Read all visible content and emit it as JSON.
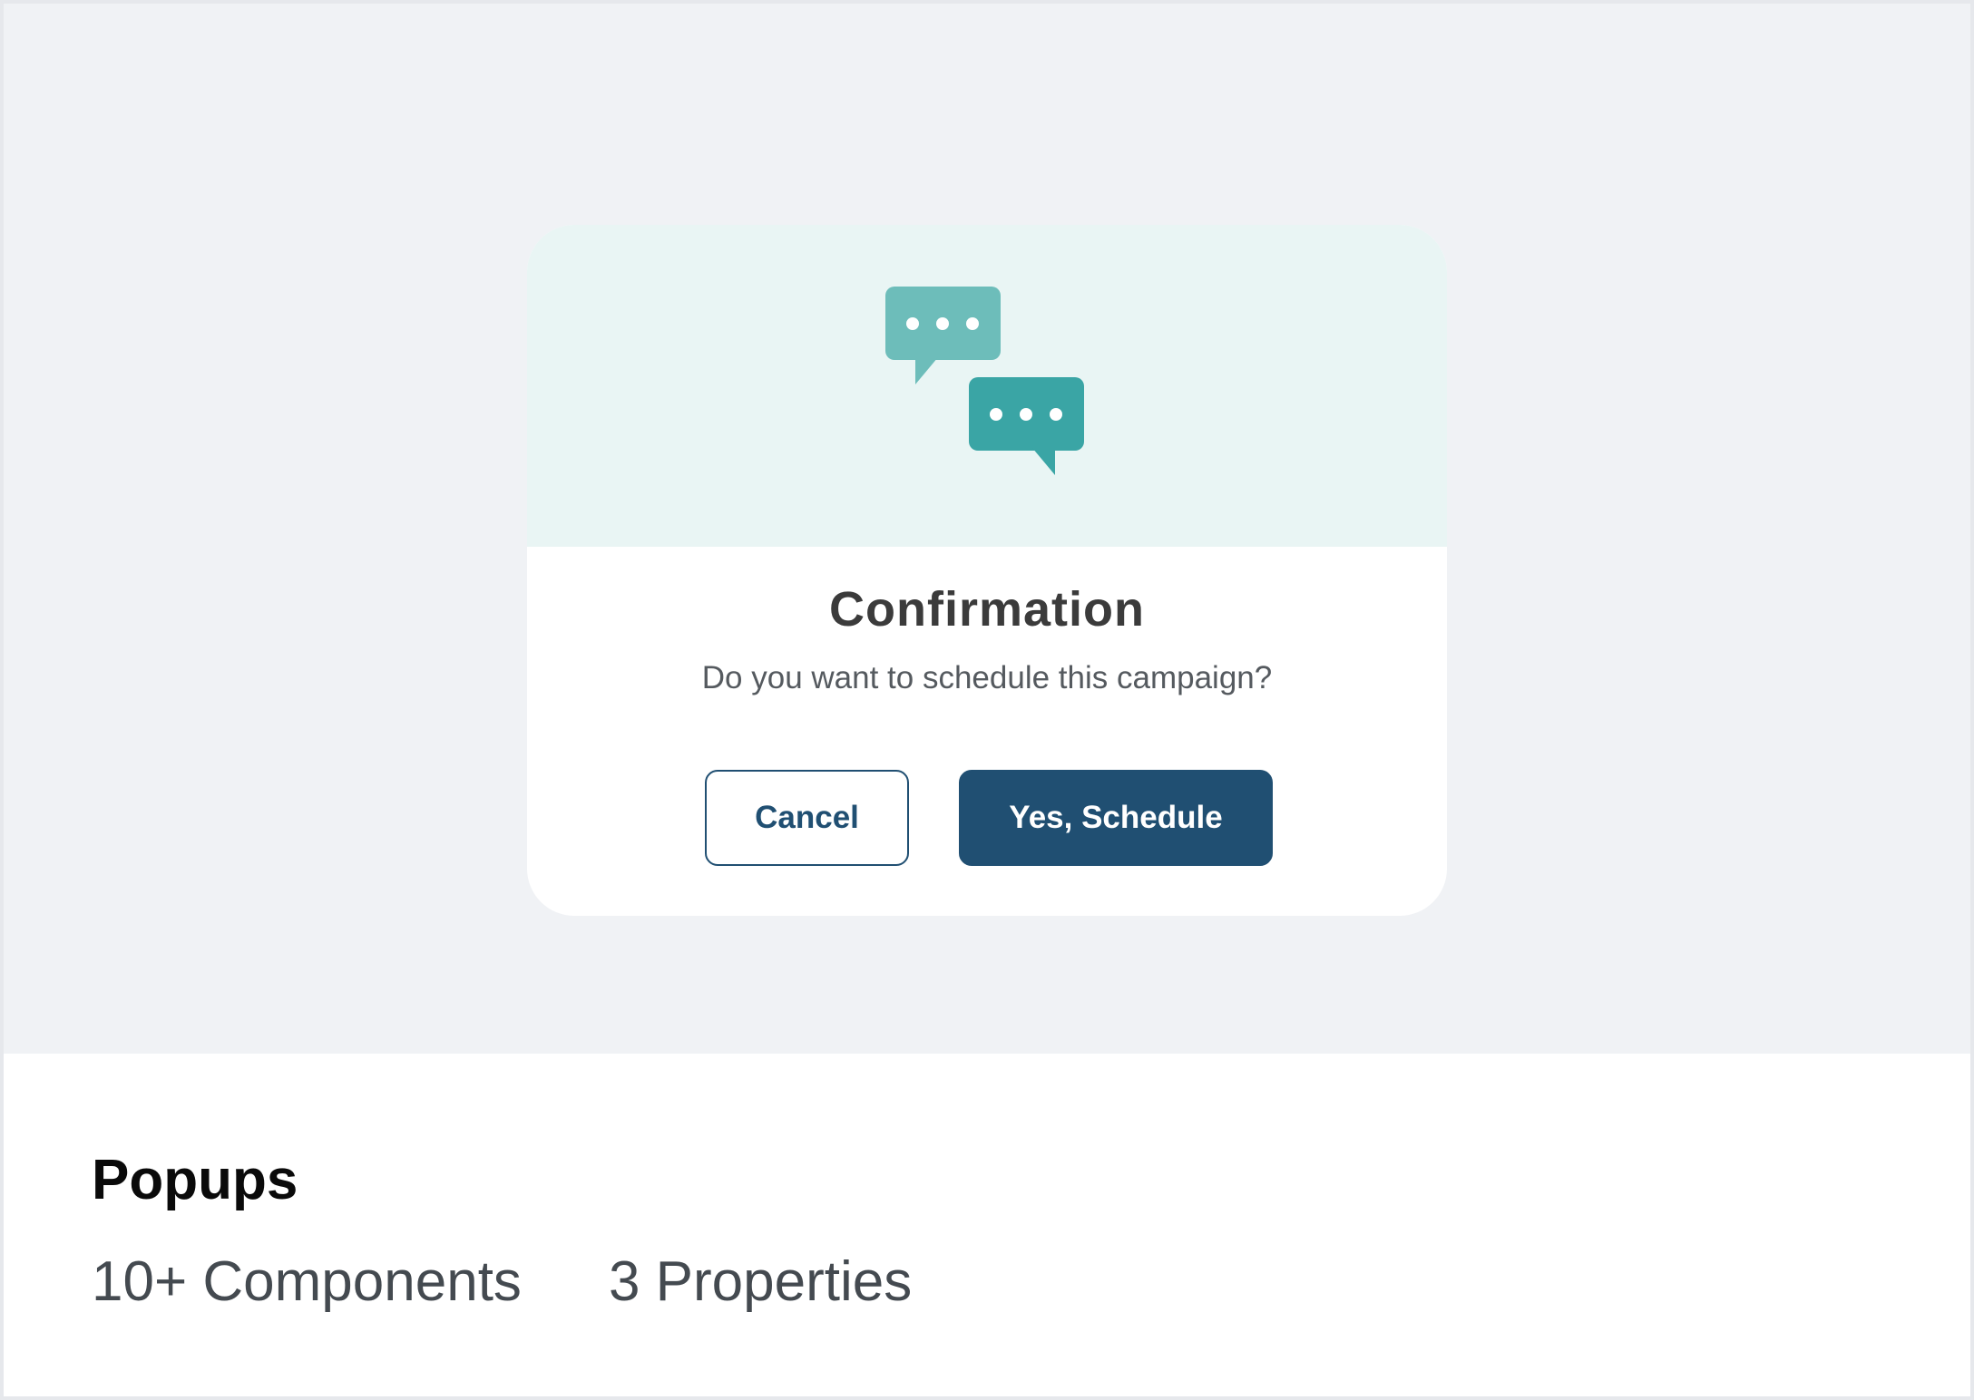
{
  "dialog": {
    "title": "Confirmation",
    "message": "Do you want to schedule this campaign?",
    "cancel_label": "Cancel",
    "confirm_label": "Yes, Schedule",
    "icon": "chat-bubbles-icon"
  },
  "footer": {
    "title": "Popups",
    "components": "10+ Components",
    "properties": "3 Properties"
  },
  "colors": {
    "hero_bg": "#e9f5f4",
    "bubble_light": "#6dbdba",
    "bubble_dark": "#3aa5a5",
    "primary": "#204f72",
    "preview_bg": "#f0f2f5"
  }
}
